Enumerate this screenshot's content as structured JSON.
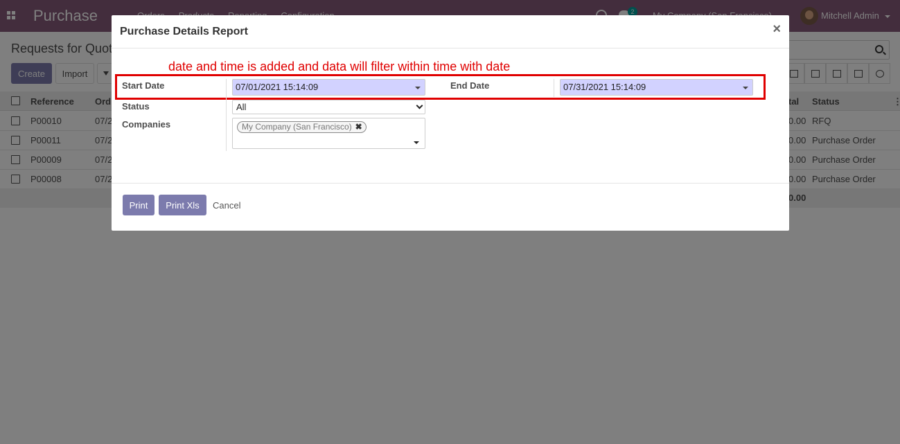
{
  "navbar": {
    "app_name": "Purchase",
    "menu": [
      "Orders",
      "Products",
      "Reporting",
      "Configuration"
    ],
    "chat_badge": "2",
    "company": "My Company (San Francisco)",
    "user": "Mitchell Admin"
  },
  "control_panel": {
    "title": "Requests for Quot",
    "create_label": "Create",
    "import_label": "Import"
  },
  "list": {
    "headers": {
      "reference": "Reference",
      "order_date": "Ord",
      "total": "tal",
      "status": "Status"
    },
    "rows": [
      {
        "reference": "P00010",
        "date": "07/2",
        "total": "0.00",
        "status": "RFQ"
      },
      {
        "reference": "P00011",
        "date": "07/2",
        "total": "0.00",
        "status": "Purchase Order"
      },
      {
        "reference": "P00009",
        "date": "07/2",
        "total": "0.00",
        "status": "Purchase Order"
      },
      {
        "reference": "P00008",
        "date": "07/2",
        "total": "0.00",
        "status": "Purchase Order"
      }
    ],
    "sum_total": "0.00"
  },
  "modal": {
    "title": "Purchase Details Report",
    "close_glyph": "×",
    "annotation": "date and time is added and data will filter within time with date",
    "start_date_label": "Start Date",
    "start_date_value": "07/01/2021 15:14:09",
    "end_date_label": "End Date",
    "end_date_value": "07/31/2021 15:14:09",
    "status_label": "Status",
    "status_value": "All",
    "companies_label": "Companies",
    "company_tag": "My Company (San Francisco)",
    "tag_remove_glyph": "✖",
    "print_label": "Print",
    "print_xls_label": "Print Xls",
    "cancel_label": "Cancel"
  },
  "colors": {
    "navbar": "#875a7b",
    "primary_button": "#7c7bad",
    "date_input_bg": "#d2d2ff",
    "annotation": "#e00000"
  }
}
